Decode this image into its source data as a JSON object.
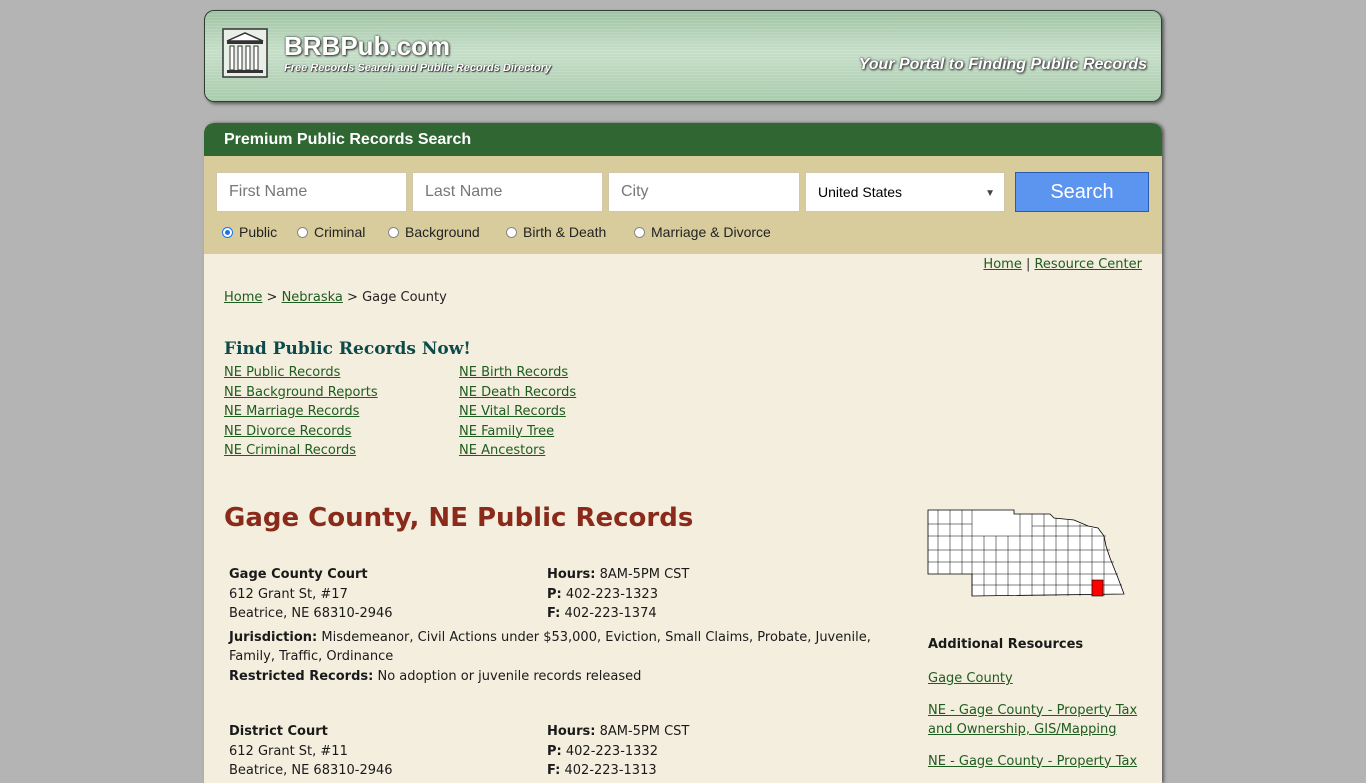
{
  "header": {
    "site_name": "BRBPub.com",
    "tagline": "Free Records Search and Public Records Directory",
    "portal_text": "Your Portal to Finding Public Records"
  },
  "search": {
    "title": "Premium Public Records Search",
    "first_name_placeholder": "First Name",
    "last_name_placeholder": "Last Name",
    "city_placeholder": "City",
    "country_selected": "United States",
    "button_label": "Search",
    "radios": [
      {
        "label": "Public",
        "checked": true
      },
      {
        "label": "Criminal",
        "checked": false
      },
      {
        "label": "Background",
        "checked": false
      },
      {
        "label": "Birth & Death",
        "checked": false
      },
      {
        "label": "Marriage & Divorce",
        "checked": false
      }
    ]
  },
  "top_links": {
    "home": "Home",
    "separator": "|",
    "resource_center": "Resource Center"
  },
  "breadcrumb": {
    "home": "Home",
    "sep": ">",
    "state": "Nebraska",
    "current": "Gage County"
  },
  "find": {
    "title": "Find Public Records Now!",
    "col1": [
      "NE Public Records",
      "NE Background Reports",
      "NE Marriage Records",
      "NE Divorce Records",
      "NE Criminal Records"
    ],
    "col2": [
      "NE Birth Records",
      "NE Death Records",
      "NE Vital Records",
      "NE Family Tree",
      "NE Ancestors"
    ]
  },
  "county_title": "Gage County, NE Public Records",
  "offices": [
    {
      "name": "Gage County Court",
      "address1": "612 Grant St, #17",
      "address2": "Beatrice, NE 68310-2946",
      "hours_label": "Hours:",
      "hours": "8AM-5PM CST",
      "phone_label": "P:",
      "phone": "402-223-1323",
      "fax_label": "F:",
      "fax": "402-223-1374",
      "jurisdiction_label": "Jurisdiction:",
      "jurisdiction": "Misdemeanor, Civil Actions under $53,000, Eviction, Small Claims, Probate, Juvenile, Family, Traffic, Ordinance",
      "restricted_label": "Restricted Records:",
      "restricted": "No adoption or juvenile records released"
    },
    {
      "name": "District Court",
      "address1": "612 Grant St, #11",
      "address2": "Beatrice, NE 68310-2946",
      "hours_label": "Hours:",
      "hours": "8AM-5PM CST",
      "phone_label": "P:",
      "phone": "402-223-1332",
      "fax_label": "F:",
      "fax": "402-223-1313"
    }
  ],
  "additional": {
    "title": "Additional Resources",
    "links": [
      "Gage County",
      "NE - Gage County - Property Tax and Ownership, GIS/Mapping",
      "NE - Gage County - Property Tax"
    ]
  },
  "colors": {
    "highlight_county": "#ff0000",
    "header_green": "#2f6632",
    "title_red": "#8a2a1a"
  }
}
